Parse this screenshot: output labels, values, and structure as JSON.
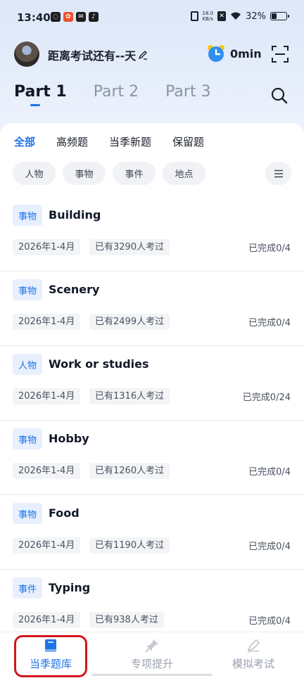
{
  "status_bar": {
    "time": "13:40",
    "net_speed_value": "18.0",
    "net_speed_unit": "KB/s",
    "battery": "32%"
  },
  "header": {
    "countdown_text": "距离考试还有--天",
    "timer_text": "0min"
  },
  "part_tabs": [
    {
      "label": "Part 1",
      "active": true
    },
    {
      "label": "Part 2",
      "active": false
    },
    {
      "label": "Part 3",
      "active": false
    }
  ],
  "category_tabs": [
    {
      "label": "全部",
      "active": true
    },
    {
      "label": "高频题",
      "active": false
    },
    {
      "label": "当季新题",
      "active": false
    },
    {
      "label": "保留题",
      "active": false
    }
  ],
  "filter_chips": [
    "人物",
    "事物",
    "事件",
    "地点"
  ],
  "topics": [
    {
      "tag": "事物",
      "title": "Building",
      "period": "2026年1-4月",
      "count": "已有3290人考过",
      "progress": "已完成0/4"
    },
    {
      "tag": "事物",
      "title": "Scenery",
      "period": "2026年1-4月",
      "count": "已有2499人考过",
      "progress": "已完成0/4"
    },
    {
      "tag": "人物",
      "title": "Work or studies",
      "period": "2026年1-4月",
      "count": "已有1316人考过",
      "progress": "已完成0/24"
    },
    {
      "tag": "事物",
      "title": "Hobby",
      "period": "2026年1-4月",
      "count": "已有1260人考过",
      "progress": "已完成0/4"
    },
    {
      "tag": "事物",
      "title": "Food",
      "period": "2026年1-4月",
      "count": "已有1190人考过",
      "progress": "已完成0/4"
    },
    {
      "tag": "事件",
      "title": "Typing",
      "period": "2026年1-4月",
      "count": "已有938人考过",
      "progress": "已完成0/4"
    }
  ],
  "bottom_nav": [
    {
      "label": "当季题库",
      "icon": "book-icon",
      "active": true
    },
    {
      "label": "专项提升",
      "icon": "pin-icon",
      "active": false
    },
    {
      "label": "模拟考试",
      "icon": "pen-icon",
      "active": false
    }
  ],
  "colors": {
    "accent": "#1e73e8",
    "highlight_ring": "#d3161b"
  }
}
